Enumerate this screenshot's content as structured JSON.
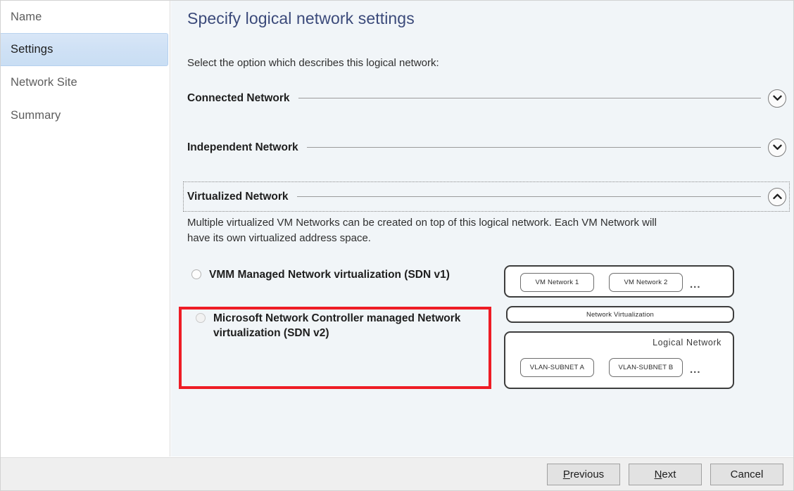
{
  "window": {
    "frame_border_color": "#d2d2d2",
    "main_background": "#f1f5f8",
    "footer_background": "#efefef"
  },
  "sidebar": {
    "items": [
      {
        "label": "Name",
        "selected": false
      },
      {
        "label": "Settings",
        "selected": true
      },
      {
        "label": "Network Site",
        "selected": false
      },
      {
        "label": "Summary",
        "selected": false
      }
    ],
    "selection_color": "#cfe1f5"
  },
  "main": {
    "title": "Specify logical network settings",
    "title_color": "#3b4a7a",
    "intro": "Select the option which describes this logical network:",
    "sections": [
      {
        "label": "Connected Network",
        "expanded": false,
        "chevron": "chevron-down-icon"
      },
      {
        "label": "Independent Network",
        "expanded": false,
        "chevron": "chevron-down-icon"
      },
      {
        "label": "Virtualized Network",
        "expanded": true,
        "chevron": "chevron-up-icon"
      }
    ],
    "virtualized": {
      "description": "Multiple virtualized VM Networks can be created on top of this logical network. Each VM Network will have its own virtualized address space.",
      "options": [
        {
          "label": "VMM Managed Network virtualization (SDN v1)",
          "selected": false,
          "dimmed": false
        },
        {
          "label": "Microsoft Network Controller managed Network virtualization (SDN v2)",
          "selected": false,
          "dimmed": true
        }
      ],
      "highlight": {
        "color": "#ee1c25",
        "target_option": "Microsoft Network Controller managed Network virtualization (SDN v2)"
      }
    },
    "diagram": {
      "vm_networks": [
        "VM Network 1",
        "VM Network 2"
      ],
      "vm_networks_more": "...",
      "virtualization_layer": "Network Virtualization",
      "logical_network_label": "Logical  Network",
      "vlan_subnets": [
        "VLAN-SUBNET A",
        "VLAN-SUBNET B"
      ],
      "vlan_subnets_more": "..."
    }
  },
  "footer": {
    "buttons": [
      {
        "label_pre": "",
        "label_key": "P",
        "label_post": "revious"
      },
      {
        "label_pre": "",
        "label_key": "N",
        "label_post": "ext"
      },
      {
        "label_pre": "Cancel",
        "label_key": "",
        "label_post": ""
      }
    ],
    "previous_label": "Previous",
    "next_label": "Next",
    "cancel_label": "Cancel"
  }
}
